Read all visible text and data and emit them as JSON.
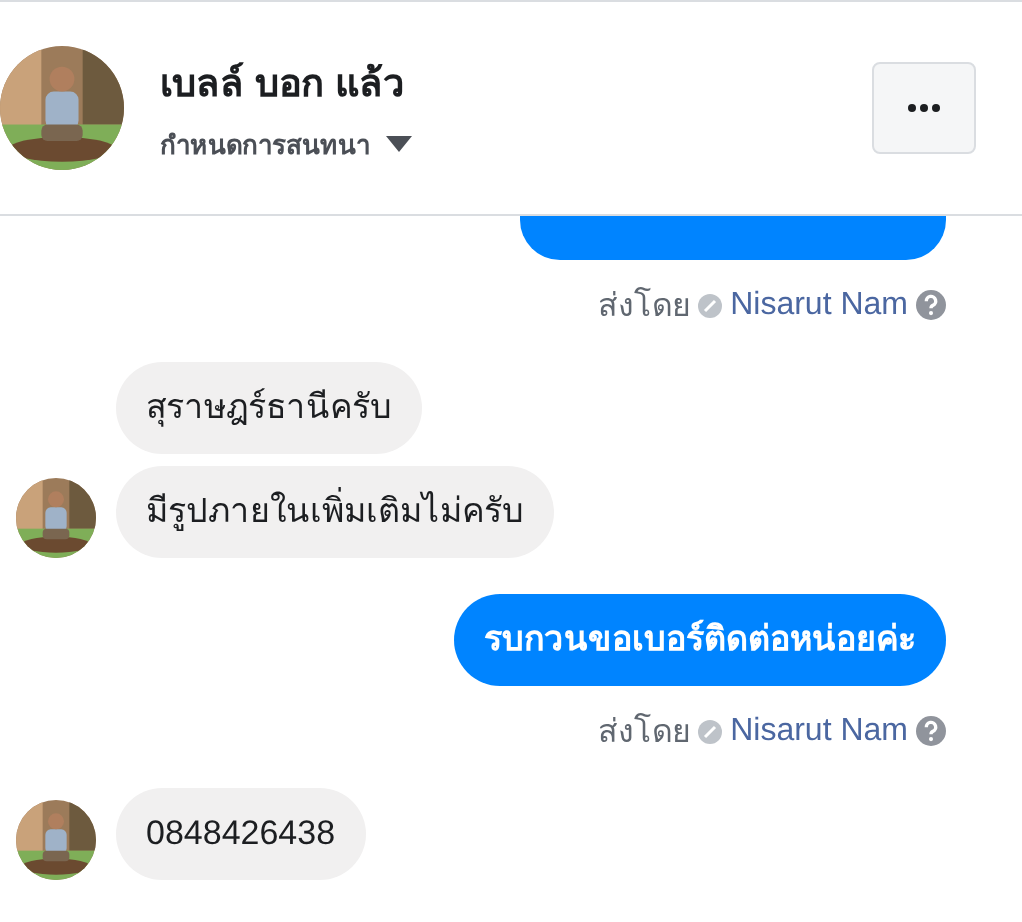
{
  "header": {
    "name": "เบลล์ บอก แล้ว",
    "subtitle": "กำหนดการสนทนา"
  },
  "messages": [
    {
      "kind": "sent_cut"
    },
    {
      "kind": "meta",
      "label": "ส่งโดย",
      "sender": "Nisarut Nam"
    },
    {
      "kind": "received",
      "text": "สุราษฎร์ธานีครับ",
      "avatar": false
    },
    {
      "kind": "received",
      "text": "มีรูปภายในเพิ่มเติมไม่ครับ",
      "avatar": true
    },
    {
      "kind": "sent",
      "text": "รบกวนขอเบอร์ติดต่อหน่อยค่ะ"
    },
    {
      "kind": "meta",
      "label": "ส่งโดย",
      "sender": "Nisarut Nam"
    },
    {
      "kind": "received",
      "text": "0848426438",
      "avatar": true
    }
  ]
}
